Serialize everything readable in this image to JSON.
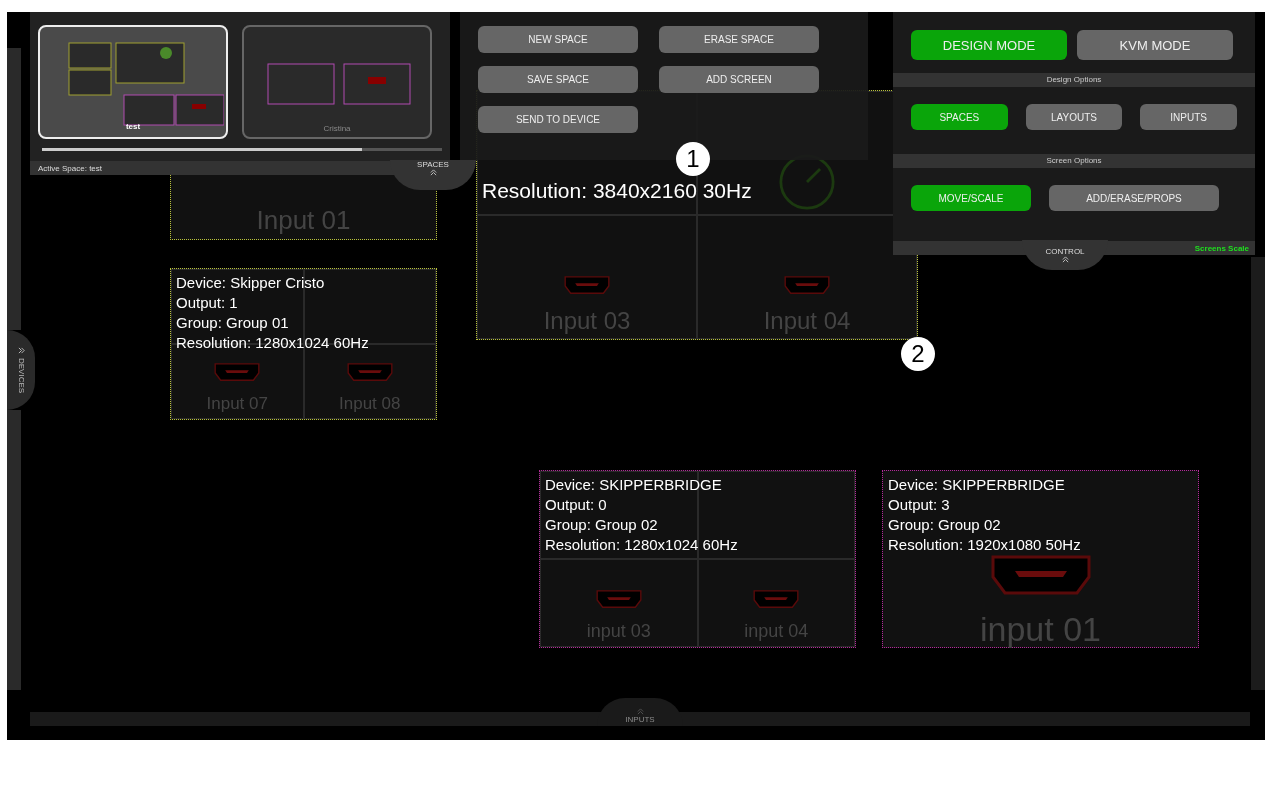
{
  "spaces_panel": {
    "spaces": [
      {
        "name": "test",
        "selected": true
      },
      {
        "name": "Cristina",
        "selected": false
      }
    ],
    "active_space": "Active Space: test",
    "tab": "SPACES"
  },
  "space_actions": [
    "NEW SPACE",
    "ERASE SPACE",
    "SAVE SPACE",
    "ADD SCREEN",
    "SEND TO DEVICE"
  ],
  "control_panel": {
    "modes": [
      {
        "label": "DESIGN MODE",
        "selected": true
      },
      {
        "label": "KVM MODE",
        "selected": false
      }
    ],
    "design_header": "Design Options",
    "design_options": [
      {
        "label": "SPACES",
        "selected": true
      },
      {
        "label": "LAYOUTS",
        "selected": false
      },
      {
        "label": "INPUTS",
        "selected": false
      }
    ],
    "screen_header": "Screen Options",
    "screen_options": [
      {
        "label": "MOVE/SCALE",
        "selected": true
      },
      {
        "label": "ADD/ERASE/PROPS",
        "selected": false
      }
    ],
    "tab": "CONTROL",
    "scale_label": "Screens Scale"
  },
  "screens": [
    {
      "kind": "single",
      "color": "#b8c23a",
      "cells": [
        {
          "kind": "blank",
          "label": "Input 01"
        }
      ]
    },
    {
      "kind": "grid",
      "color": "#b8c23a",
      "info": [
        "Resolution: 3840x2160 30Hz"
      ],
      "cells": [
        {
          "kind": "blank"
        },
        {
          "kind": "radar"
        },
        {
          "kind": "port",
          "label": "Input 03"
        },
        {
          "kind": "port",
          "label": "Input 04"
        }
      ]
    },
    {
      "kind": "grid",
      "color": "#b8c23a",
      "info": [
        "Device: Skipper Cristo",
        "Output: 1",
        "Group: Group 01",
        "Resolution: 1280x1024 60Hz"
      ],
      "cells": [
        {
          "kind": "blank"
        },
        {
          "kind": "blank"
        },
        {
          "kind": "port",
          "label": "Input 07"
        },
        {
          "kind": "port",
          "label": "Input 08"
        }
      ]
    },
    {
      "kind": "grid",
      "color": "#b4289a",
      "info": [
        "Device: SKIPPERBRIDGE",
        "Output: 0",
        "Group: Group 02",
        "Resolution: 1280x1024 60Hz"
      ],
      "cells": [
        {
          "kind": "blank"
        },
        {
          "kind": "blank"
        },
        {
          "kind": "port",
          "label": "input 03"
        },
        {
          "kind": "port",
          "label": "input 04"
        }
      ]
    },
    {
      "kind": "single",
      "color": "#b4289a",
      "info": [
        "Device: SKIPPERBRIDGE",
        "Output: 3",
        "Group: Group 02",
        "Resolution: 1920x1080 50Hz"
      ],
      "cells": [
        {
          "kind": "port",
          "label": "input 01"
        }
      ]
    }
  ],
  "markers": [
    "1",
    "2"
  ],
  "side_tabs": {
    "left": "DEVICES",
    "bottom": "INPUTS"
  }
}
